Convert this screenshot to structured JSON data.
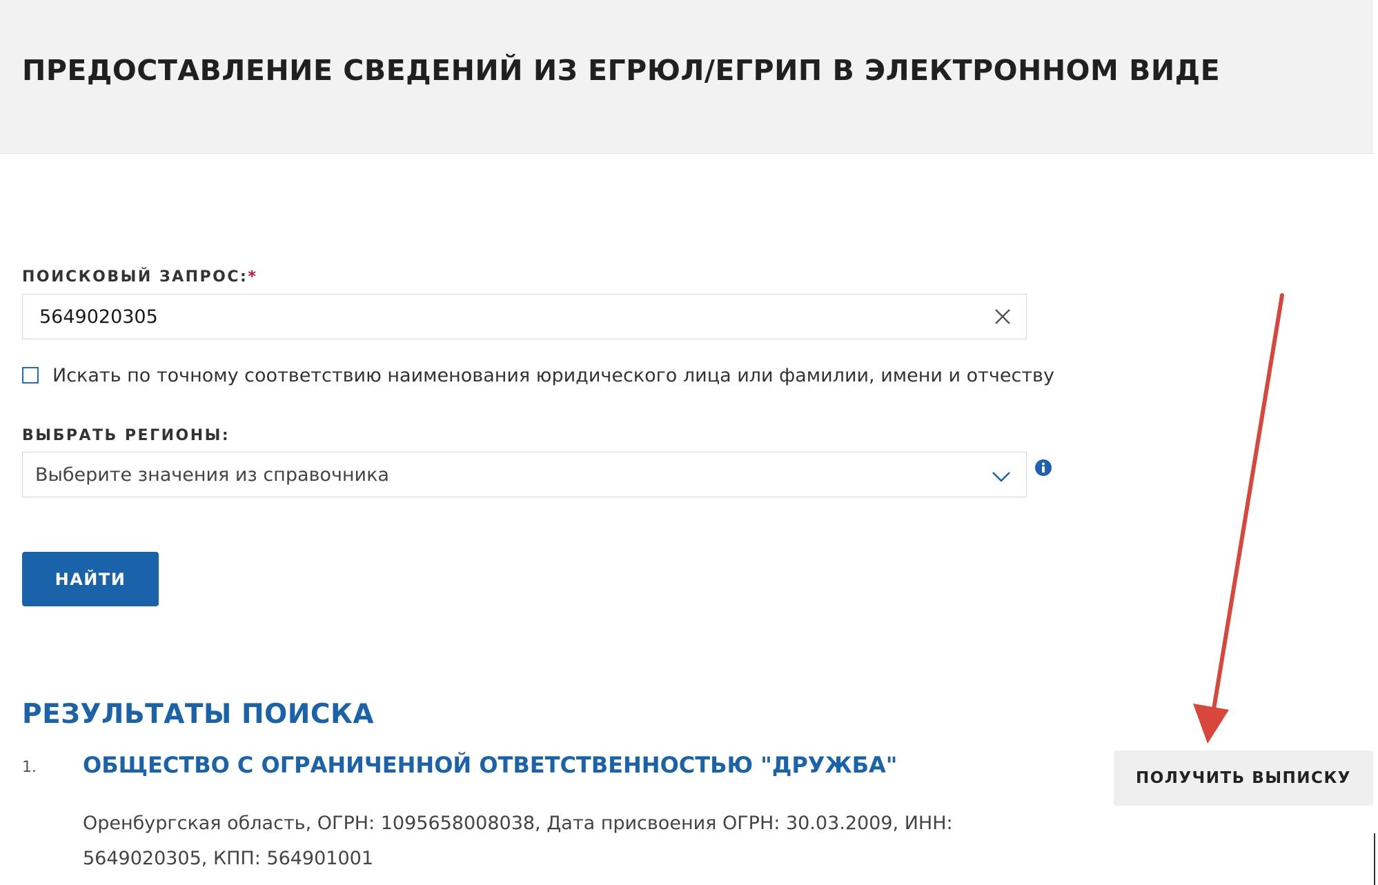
{
  "header": {
    "title": "ПРЕДОСТАВЛЕНИЕ СВЕДЕНИЙ ИЗ ЕГРЮЛ/ЕГРИП В ЭЛЕКТРОННОМ ВИДЕ"
  },
  "form": {
    "query_label": "ПОИСКОВЫЙ ЗАПРОС:",
    "required_mark": "*",
    "query_value": "5649020305",
    "exact_match_label": "Искать по точному соответствию наименования юридического лица или фамилии, имени и отчеству",
    "exact_match_checked": false,
    "regions_label": "ВЫБРАТЬ РЕГИОНЫ:",
    "regions_placeholder": "Выберите значения из справочника",
    "find_button": "НАЙТИ"
  },
  "results": {
    "title": "РЕЗУЛЬТАТЫ ПОИСКА",
    "items": [
      {
        "number": "1.",
        "name": "ОБЩЕСТВО С ОГРАНИЧЕННОЙ ОТВЕТСТВЕННОСТЬЮ \"ДРУЖБА\"",
        "details": "Оренбургская область, ОГРН: 1095658008038, Дата присвоения ОГРН: 30.03.2009, ИНН: 5649020305, КПП: 564901001",
        "action_button": "ПОЛУЧИТЬ ВЫПИСКУ"
      }
    ]
  },
  "icons": {
    "clear": "close-icon",
    "dropdown": "chevron-down-icon",
    "info": "info-icon",
    "annotation": "arrow-icon"
  },
  "colors": {
    "primary": "#1a63aa",
    "header_bg": "#f2f2f2",
    "required": "#c8102e",
    "annotation_arrow": "#d9473c",
    "secondary_button_bg": "#efefef"
  }
}
